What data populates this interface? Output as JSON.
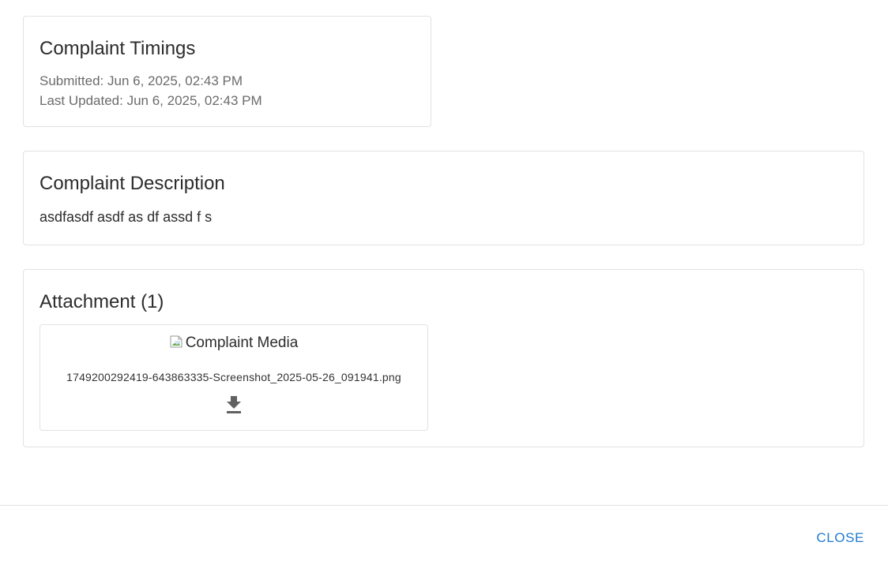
{
  "timings": {
    "title": "Complaint Timings",
    "submitted": "Submitted: Jun 6, 2025, 02:43 PM",
    "last_updated": "Last Updated: Jun 6, 2025, 02:43 PM"
  },
  "description": {
    "title": "Complaint Description",
    "text": "asdfasdf asdf as df assd f s"
  },
  "attachments": {
    "title": "Attachment (1)",
    "items": [
      {
        "image_alt": "Complaint Media",
        "filename": "1749200292419-643863335-Screenshot_2025-05-26_091941.png",
        "download_icon": "download-icon"
      }
    ]
  },
  "footer": {
    "close_label": "CLOSE"
  },
  "colors": {
    "accent": "#1f7bd1",
    "border": "#e2e2e2",
    "muted_text": "#6b6b6b"
  }
}
